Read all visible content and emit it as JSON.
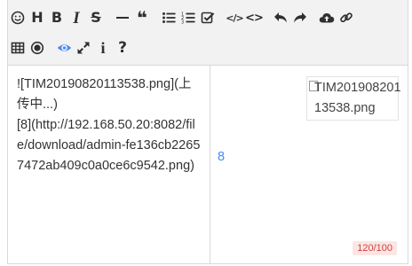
{
  "toolbar": {
    "row1": [
      {
        "name": "emoji-icon"
      },
      {
        "name": "heading-icon",
        "glyph": "H"
      },
      {
        "name": "bold-icon",
        "glyph": "B"
      },
      {
        "name": "italic-icon",
        "glyph": "I"
      },
      {
        "name": "strikethrough-icon",
        "glyph": "S"
      },
      {
        "name": "horizontal-rule-icon"
      },
      {
        "name": "quote-icon",
        "glyph": "❝"
      },
      {
        "name": "unordered-list-icon"
      },
      {
        "name": "ordered-list-icon"
      },
      {
        "name": "task-list-icon"
      },
      {
        "name": "code-icon",
        "glyph": "</>"
      },
      {
        "name": "code-block-icon",
        "glyph": "<>"
      },
      {
        "name": "undo-icon"
      },
      {
        "name": "redo-icon"
      },
      {
        "name": "upload-icon"
      },
      {
        "name": "link-icon"
      }
    ],
    "row2": [
      {
        "name": "table-icon"
      },
      {
        "name": "record-icon"
      },
      {
        "name": "preview-eye-icon"
      },
      {
        "name": "fullscreen-icon"
      },
      {
        "name": "info-icon",
        "glyph": "i"
      },
      {
        "name": "help-icon",
        "glyph": "?"
      }
    ]
  },
  "editor": {
    "source_text": "![TIM20190820113538.png](上传中...)\n[8](http://192.168.50.20:8082/file/download/admin-fe136cb22657472ab409c0a0ce6c9542.png)"
  },
  "preview": {
    "image_alt": "TIM20190820113538.png",
    "link_text": "8"
  },
  "counter": {
    "text": "120/100"
  },
  "colors": {
    "toolbar_bg": "#f2f2f2",
    "accent": "#4a8af4",
    "counter_bg": "#fbe6e4",
    "counter_text": "#d0433a"
  }
}
